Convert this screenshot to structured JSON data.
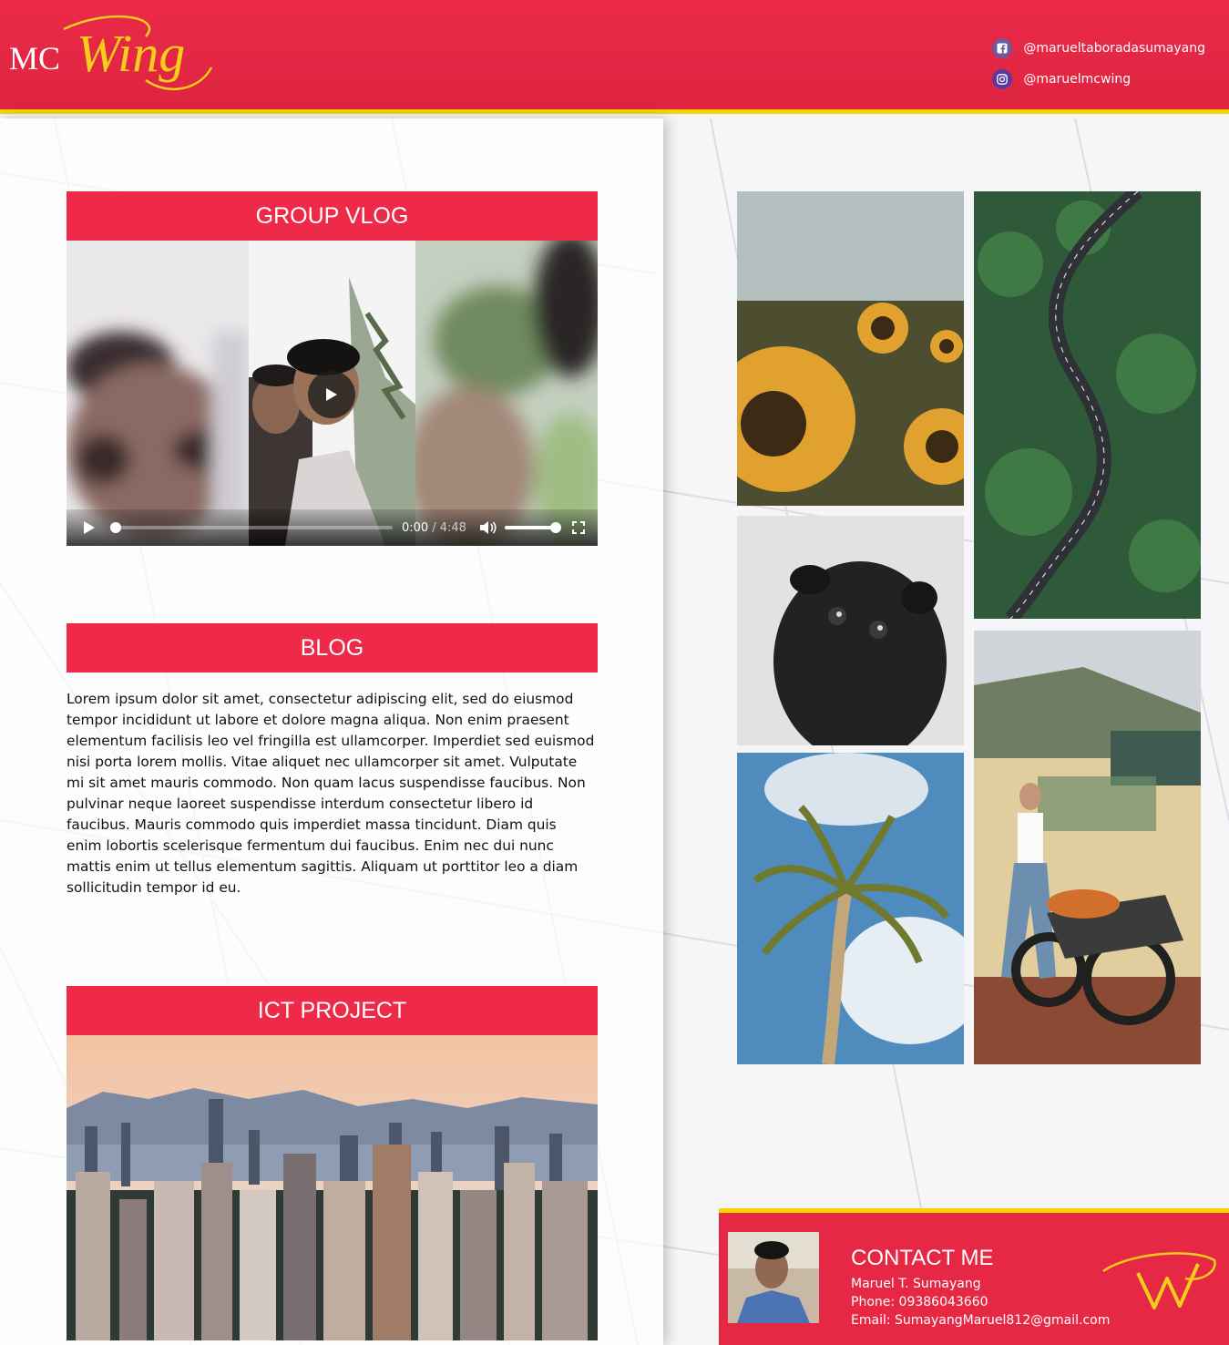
{
  "brand": {
    "logo_prefix": "MC",
    "logo_script": "Wing",
    "accent": "#ee2a48",
    "gold": "#f7d400"
  },
  "social": [
    {
      "icon": "facebook-icon",
      "handle": "@marueltaboradasumayang"
    },
    {
      "icon": "instagram-icon",
      "handle": "@maruelmcwing"
    }
  ],
  "sections": {
    "vlog": {
      "title": "GROUP VLOG"
    },
    "blog": {
      "title": "BLOG"
    },
    "ict": {
      "title": "ICT PROJECT"
    }
  },
  "video": {
    "current_time": "0:00",
    "duration": "/ 4:48",
    "progress": 0,
    "volume": 1.0
  },
  "blog": {
    "text": "Lorem ipsum dolor sit amet, consectetur adipiscing elit, sed do eiusmod tempor incididunt ut labore et dolore magna aliqua. Non enim praesent elementum facilisis leo vel fringilla est ullamcorper. Imperdiet sed euismod nisi porta lorem mollis. Vitae aliquet nec ullamcorper sit amet. Vulputate mi sit amet mauris commodo. Non quam lacus suspendisse faucibus. Non pulvinar neque laoreet suspendisse interdum consectetur libero id faucibus. Mauris commodo quis imperdiet massa tincidunt. Diam quis enim lobortis scelerisque fermentum dui faucibus. Enim nec dui nunc mattis enim ut tellus elementum sagittis. Aliquam ut porttitor leo a diam sollicitudin tempor id eu."
  },
  "gallery": [
    "sunflowers",
    "winding-road",
    "pug",
    "palm-tree",
    "girl-motorcycle"
  ],
  "contact": {
    "title": "CONTACT ME",
    "name": "Maruel T. Sumayang",
    "phone": "Phone: 09386043660",
    "email": "Email: SumayangMaruel812@gmail.com"
  }
}
